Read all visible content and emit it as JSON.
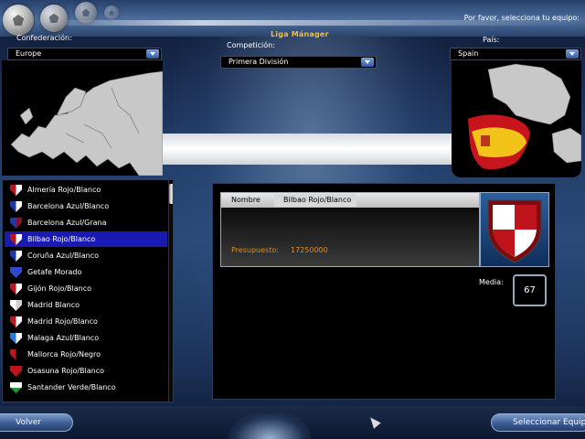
{
  "header": {
    "app_title": "Liga Mánager",
    "prompt": "Por favor, selecciona tu equipo:"
  },
  "filters": {
    "confederation": {
      "label": "Confederación:",
      "value": "Europe"
    },
    "competition": {
      "label": "Competición:",
      "value": "Primera División"
    },
    "country": {
      "label": "País:",
      "value": "Spain"
    }
  },
  "teams": [
    {
      "name": "Almería Rojo/Blanco",
      "colors": [
        "#c0141c",
        "#ffffff"
      ]
    },
    {
      "name": "Barcelona Azul/Blanco",
      "colors": [
        "#1a3aa8",
        "#ffffff"
      ]
    },
    {
      "name": "Barcelona Azul/Grana",
      "colors": [
        "#1a3aa8",
        "#8a1030"
      ]
    },
    {
      "name": "Bilbao Rojo/Blanco",
      "colors": [
        "#c0141c",
        "#ffffff"
      ],
      "selected": true
    },
    {
      "name": "Coruña Azul/Blanco",
      "colors": [
        "#1a3aa8",
        "#ffffff"
      ]
    },
    {
      "name": "Getafe Morado",
      "colors": [
        "#2f49c8",
        "#2f49c8"
      ]
    },
    {
      "name": "Gijón Rojo/Blanco",
      "colors": [
        "#c0141c",
        "#ffffff"
      ]
    },
    {
      "name": "Madrid Blanco",
      "colors": [
        "#ffffff",
        "#cfcfcf"
      ]
    },
    {
      "name": "Madrid Rojo/Blanco",
      "colors": [
        "#c0141c",
        "#ffffff"
      ]
    },
    {
      "name": "Malaga Azul/Blanco",
      "colors": [
        "#2a7ad8",
        "#ffffff"
      ]
    },
    {
      "name": "Mallorca Rojo/Negro",
      "colors": [
        "#c0141c",
        "#000000"
      ]
    },
    {
      "name": "Osasuna Rojo/Blanco",
      "colors": [
        "#c0141c",
        "#c0141c"
      ]
    },
    {
      "name": "Santander Verde/Blanco",
      "colors": [
        "#1e9a3a",
        "#ffffff"
      ]
    }
  ],
  "team_details": {
    "name_label": "Nombre",
    "name_value": "Bilbao Rojo/Blanco",
    "budget_label": "Presupuesto:",
    "budget_value": "17250000",
    "media_label": "Media:",
    "media_value": "67",
    "crest_colors": [
      "#c0141c",
      "#ffffff"
    ]
  },
  "buttons": {
    "back": "Volver",
    "select": "Seleccionar Equipo"
  },
  "colors": {
    "accent_orange": "#e08a20",
    "title_gold": "#f0c040",
    "selection_blue": "#1a1ab0"
  }
}
